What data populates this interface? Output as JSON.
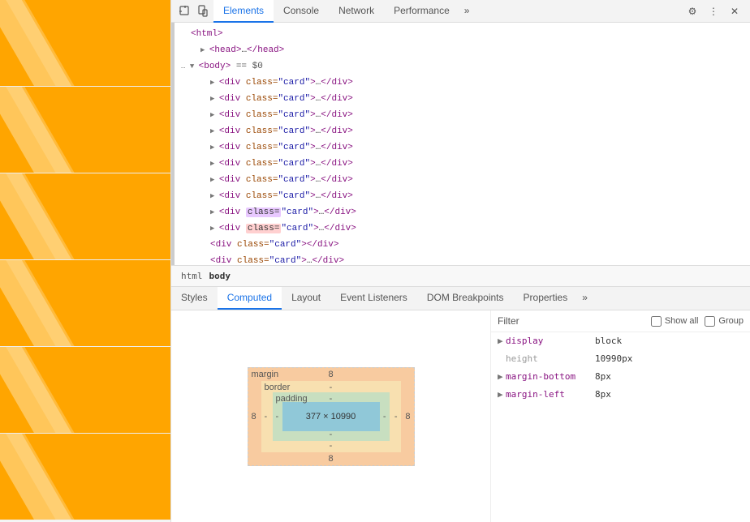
{
  "left_panel": {
    "cards": [
      {
        "id": 1
      },
      {
        "id": 2
      },
      {
        "id": 3
      },
      {
        "id": 4
      },
      {
        "id": 5
      },
      {
        "id": 6
      }
    ]
  },
  "devtools": {
    "toolbar": {
      "tabs": [
        {
          "label": "Elements",
          "active": true
        },
        {
          "label": "Console",
          "active": false
        },
        {
          "label": "Network",
          "active": false
        },
        {
          "label": "Performance",
          "active": false
        },
        {
          "label": "»",
          "active": false
        }
      ],
      "icons": {
        "inspect": "⬜",
        "device": "📱",
        "more": "⋮",
        "settings": "⚙",
        "close": "✕"
      }
    },
    "dom_tree": {
      "lines": [
        {
          "indent": 0,
          "content": "<html>",
          "type": "tag",
          "selected": false
        },
        {
          "indent": 1,
          "content": "▶ <head>…</head>",
          "type": "tag",
          "selected": false
        },
        {
          "indent": 0,
          "content": "▼ <body> == $0",
          "type": "special",
          "selected": false
        },
        {
          "indent": 2,
          "content": "▶ <div class=\"card\">…</div>",
          "type": "tag",
          "selected": false
        },
        {
          "indent": 2,
          "content": "▶ <div class=\"card\">…</div>",
          "type": "tag",
          "selected": false
        },
        {
          "indent": 2,
          "content": "▶ <div class=\"card\">…</div>",
          "type": "tag",
          "selected": false
        },
        {
          "indent": 2,
          "content": "▶ <div class=\"card\">…</div>",
          "type": "tag",
          "selected": false
        },
        {
          "indent": 2,
          "content": "▶ <div class=\"card\">…</div>",
          "type": "tag",
          "selected": false
        },
        {
          "indent": 2,
          "content": "▶ <div class=\"card\">…</div>",
          "type": "tag",
          "selected": false
        },
        {
          "indent": 2,
          "content": "▶ <div class=\"card\">…</div>",
          "type": "tag",
          "selected": false
        },
        {
          "indent": 2,
          "content": "▶ <div class=\"card\">…</div>",
          "type": "tag",
          "selected": false
        },
        {
          "indent": 2,
          "content": "▶ <div class=\"card\">…</div>",
          "type": "tag",
          "selected": false,
          "highlight1": true
        },
        {
          "indent": 2,
          "content": "▶ <div class=\"card\">…</div>",
          "type": "tag",
          "selected": false,
          "highlight2": true
        },
        {
          "indent": 2,
          "content": "<div class=\"card\"></div>",
          "type": "tag",
          "selected": false
        },
        {
          "indent": 2,
          "content": "<div class=\"card\">…</div>",
          "type": "tag",
          "selected": false
        }
      ]
    },
    "breadcrumb": {
      "items": [
        {
          "label": "html",
          "active": false
        },
        {
          "label": "body",
          "active": true
        }
      ]
    },
    "panel_tabs": [
      {
        "label": "Styles",
        "active": false
      },
      {
        "label": "Computed",
        "active": true
      },
      {
        "label": "Layout",
        "active": false
      },
      {
        "label": "Event Listeners",
        "active": false
      },
      {
        "label": "DOM Breakpoints",
        "active": false
      },
      {
        "label": "Properties",
        "active": false
      },
      {
        "label": "»",
        "active": false
      }
    ],
    "box_model": {
      "margin": {
        "top": "8",
        "bottom": "8",
        "left": "8",
        "right": "8",
        "label": "margin"
      },
      "border": {
        "top": "-",
        "bottom": "-",
        "left": "-",
        "right": "-",
        "label": "border"
      },
      "padding": {
        "top": "-",
        "bottom": "-",
        "left": "-",
        "right": "-",
        "label": "padding"
      },
      "content": {
        "width": "377",
        "height": "10990",
        "label": "377 × 10990"
      }
    },
    "filter_bar": {
      "label": "Filter",
      "show_all": {
        "label": "Show all"
      },
      "group": {
        "label": "Group"
      }
    },
    "computed_props": [
      {
        "name": "display",
        "value": "block",
        "has_disclosure": true,
        "active": true
      },
      {
        "name": "height",
        "value": "10990px",
        "has_disclosure": false,
        "active": false,
        "dim": true
      },
      {
        "name": "margin-bottom",
        "value": "8px",
        "has_disclosure": true,
        "active": true
      },
      {
        "name": "margin-left",
        "value": "8px",
        "has_disclosure": true,
        "active": true
      }
    ]
  }
}
